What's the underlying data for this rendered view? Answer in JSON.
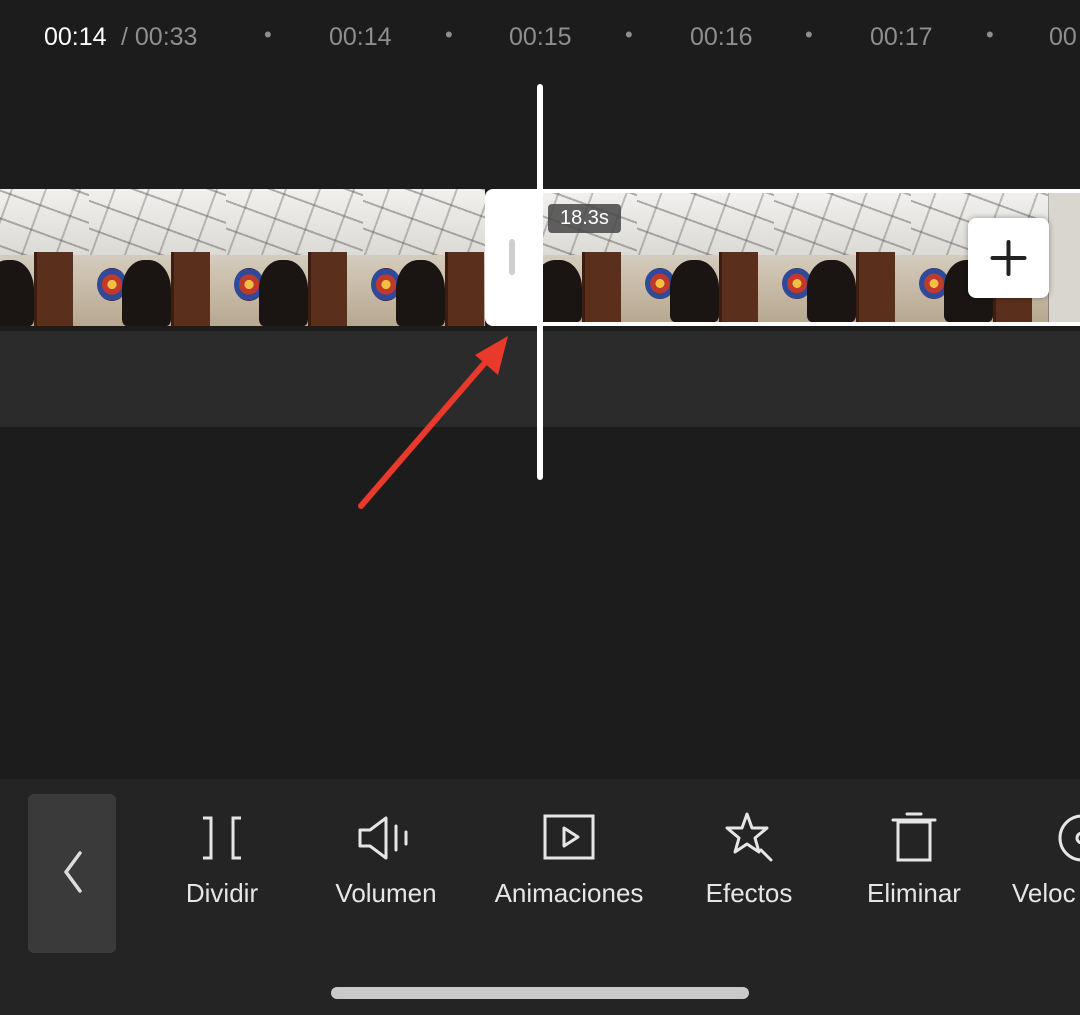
{
  "timeline": {
    "current_time": "00:14",
    "total_time": "/ 00:33",
    "markers": [
      "00:14",
      "00:15",
      "00:16",
      "00:17",
      "00"
    ],
    "clip_duration": "18.3s"
  },
  "colors": {
    "background": "#1c1c1c",
    "toolbar": "#242424",
    "playhead": "#ffffff",
    "arrow": "#e8392b"
  },
  "toolbar": {
    "tools": [
      {
        "label": "Dividir",
        "icon": "split-icon"
      },
      {
        "label": "Volumen",
        "icon": "volume-icon"
      },
      {
        "label": "Animaciones",
        "icon": "animation-icon"
      },
      {
        "label": "Efectos",
        "icon": "effects-icon"
      },
      {
        "label": "Eliminar",
        "icon": "delete-icon"
      },
      {
        "label": "Veloc",
        "icon": "speed-icon"
      }
    ]
  }
}
